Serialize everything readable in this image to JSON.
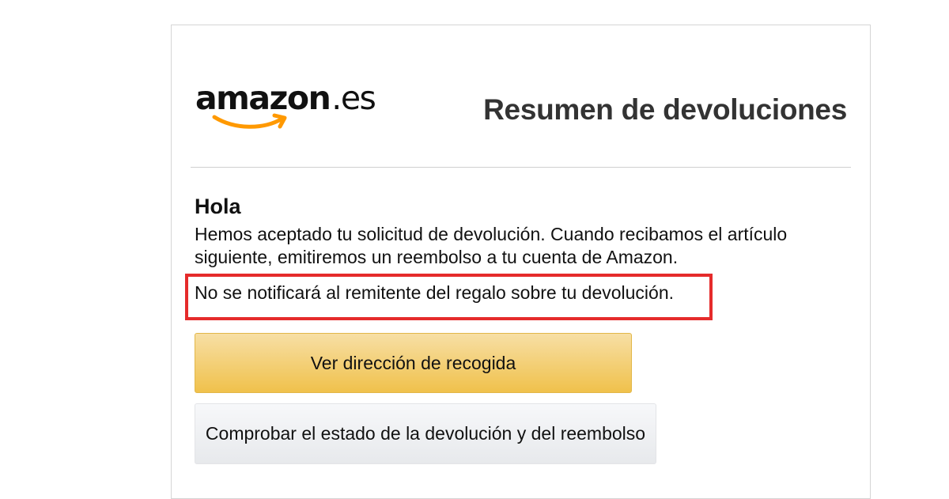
{
  "logo": {
    "main": "amazon",
    "tld": ".es"
  },
  "header": {
    "title": "Resumen de devoluciones"
  },
  "body": {
    "greeting": "Hola",
    "message": "Hemos aceptado tu solicitud de devolución. Cuando recibamos el artículo siguiente, emitiremos un reembolso a tu cuenta de Amazon.",
    "notice": "No se notificará al remitente del regalo sobre tu devolución."
  },
  "actions": {
    "primary_label": "Ver dirección de recogida",
    "secondary_label": "Comprobar el estado de la devolución y del reembolso"
  },
  "colors": {
    "brand_orange": "#ff9900",
    "primary_button": "#f0c14b",
    "highlight_border": "#e52b2b"
  },
  "icons": {
    "logo_smile": "amazon-smile-arrow"
  }
}
